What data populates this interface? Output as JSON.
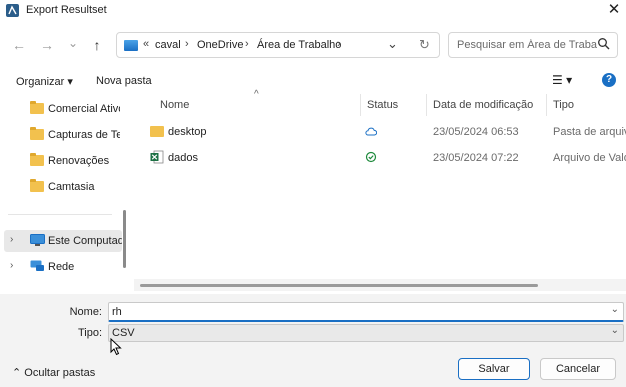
{
  "window": {
    "title": "Export Resultset",
    "close_glyph": "✕"
  },
  "nav": {
    "back": "←",
    "forward": "→",
    "recent": "⌄",
    "up": "↑",
    "address": [
      "«",
      "caval",
      "›",
      "OneDrive",
      "›",
      "Área de Trabalho",
      "›"
    ],
    "address_dropdown": "⌄",
    "refresh": "↻"
  },
  "search": {
    "placeholder": "Pesquisar em Área de Traba...",
    "icon": "search-icon"
  },
  "toolbar": {
    "organize": "Organizar ▾",
    "new_folder": "Nova pasta",
    "view": "☰ ▾",
    "help": "?"
  },
  "sidebar": {
    "items": [
      {
        "label": "Comercial Ativo",
        "icon": "folder-icon"
      },
      {
        "label": "Capturas de Tela",
        "icon": "folder-icon"
      },
      {
        "label": "Renovações",
        "icon": "folder-icon"
      },
      {
        "label": "Camtasia",
        "icon": "folder-icon"
      }
    ],
    "computer": {
      "label": "Este Computador",
      "chevron": "›",
      "icon": "computer-icon"
    },
    "network": {
      "label": "Rede",
      "chevron": "›",
      "icon": "network-icon"
    }
  },
  "files": {
    "sort_indicator": "^",
    "columns": [
      "Nome",
      "Status",
      "Data de modificação",
      "Tipo"
    ],
    "rows": [
      {
        "name": "desktop",
        "status_icon": "cloud-icon",
        "date": "23/05/2024 06:53",
        "type": "Pasta de arquivo"
      },
      {
        "name": "dados",
        "status_icon": "check-circle-icon",
        "date": "23/05/2024 07:22",
        "type": "Arquivo de Valor"
      }
    ]
  },
  "form": {
    "name_label": "Nome:",
    "name_value": "rh",
    "type_label": "Tipo:",
    "type_value": "CSV"
  },
  "footer": {
    "hide_folders": "⌃  Ocultar pastas",
    "save": "Salvar",
    "cancel": "Cancelar"
  },
  "colors": {
    "accent": "#1a6fc4",
    "folder": "#f2c14e",
    "excel": "#1e7145"
  }
}
